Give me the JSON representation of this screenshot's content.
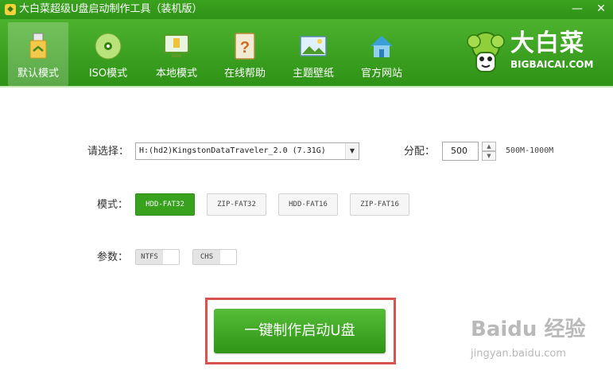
{
  "window": {
    "title": "大白菜超级U盘启动制作工具（装机版）",
    "min_label": "—",
    "close_label": "✕"
  },
  "tabs": [
    {
      "label": "默认模式",
      "icon": "usb-drive-icon"
    },
    {
      "label": "ISO模式",
      "icon": "disc-icon"
    },
    {
      "label": "本地模式",
      "icon": "monitor-icon"
    },
    {
      "label": "在线帮助",
      "icon": "help-book-icon"
    },
    {
      "label": "主题壁纸",
      "icon": "wallpaper-icon"
    },
    {
      "label": "官方网站",
      "icon": "home-icon"
    }
  ],
  "logo": {
    "text": "大白菜",
    "sub": "BIGBAICAI.COM"
  },
  "select": {
    "label": "请选择：",
    "value": "H:(hd2)KingstonDataTraveler_2.0 (7.31G)"
  },
  "alloc": {
    "label": "分配：",
    "value": "500",
    "range": "500M-1000M"
  },
  "mode": {
    "label": "模式：",
    "options": [
      "HDD-FAT32",
      "ZIP-FAT32",
      "HDD-FAT16",
      "ZIP-FAT16"
    ],
    "selected": "HDD-FAT32"
  },
  "params": {
    "label": "参数：",
    "toggles": [
      {
        "label": "NTFS",
        "on": false
      },
      {
        "label": "CHS",
        "on": false
      }
    ]
  },
  "action": {
    "label": "一键制作启动U盘"
  },
  "watermark": {
    "main": "Baidu 经验",
    "sub": "jingyan.baidu.com"
  },
  "colors": {
    "brand_green": "#2e9216",
    "highlight_red": "#d9534f"
  }
}
